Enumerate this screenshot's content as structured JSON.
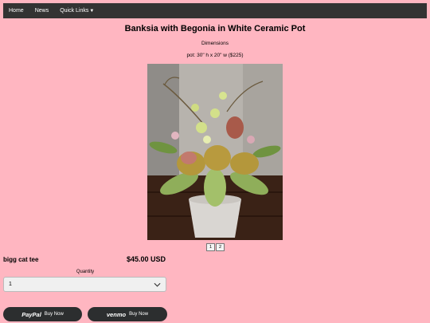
{
  "nav": {
    "items": [
      "Home",
      "News",
      "Quick Links"
    ]
  },
  "product": {
    "title": "Banksia with Begonia in White Ceramic Pot",
    "dimensions_label": "Dimensions",
    "dimensions_value": "pot: 30\" h x 20\" w ($225)",
    "name": "bigg cat tee",
    "price": "$45.00 USD",
    "thumbnails": [
      "1",
      "2"
    ]
  },
  "quantity": {
    "label": "Quantity",
    "value": "1"
  },
  "payments": {
    "paypal_logo": "PayPal",
    "paypal_text": "Buy Now",
    "venmo_logo": "venmo",
    "venmo_text": "Buy Now"
  },
  "colors": {
    "background": "#ffb6c1",
    "navbar": "#333333",
    "button": "#2c2e2f"
  }
}
